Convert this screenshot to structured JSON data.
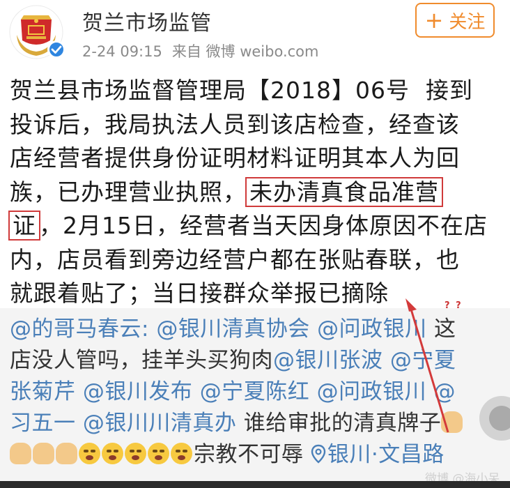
{
  "header": {
    "account_name": "贺兰市场监管",
    "timestamp": "2-24 09:15",
    "source": "来自 微博 weibo.com",
    "follow_plus": "+",
    "follow_label": "关注"
  },
  "post": {
    "line1_a": "贺兰县市场监督管理局【2018】06号",
    "line1_b": "接到",
    "line2": "投诉后，我局执法人员到该店检查，经查该",
    "line3": "店经营者提供身份证明材料证明其本人为回",
    "line4_a": "族，已办理营业执照，",
    "highlight_1": "未办清真食品准营",
    "highlight_2": "证",
    "line5_rest": "，2月15日，经营者当天因身体原因不在店",
    "line6": "内，店员看到旁边经营户都在张贴春联，也",
    "line7_a": "就跟着贴了；",
    "underlined": "当日接群众举报已摘除"
  },
  "annotation": {
    "question_marks": "? ?",
    "arrow_color": "#d33a3a"
  },
  "repost": {
    "m1": "@的哥马春云:",
    "m2": "@银川清真协会",
    "m3": "@问政银川",
    "t1": "这",
    "t2": "店没人管吗，挂羊头买狗肉",
    "m4": "@银川张波",
    "m5": "@宁夏",
    "m5b": "张菊芹",
    "m6": "@银川发布",
    "m7": "@宁夏陈红",
    "m8": "@问政银川",
    "m9": "@",
    "m9b": "习五一",
    "m10": "@银川川清真办",
    "t3": "谁给审批的清真牌子",
    "t4": "宗教不可辱",
    "location": "银川·文昌路",
    "emoji_icons": [
      "pray-emoji",
      "cry-emoji"
    ]
  },
  "watermark": "微博 @海小呆",
  "colors": {
    "brand_orange": "#f08b2c",
    "mention_blue": "#4a7fb8",
    "highlight_red": "#d03a3a",
    "verify_blue": "#2f86e0"
  }
}
